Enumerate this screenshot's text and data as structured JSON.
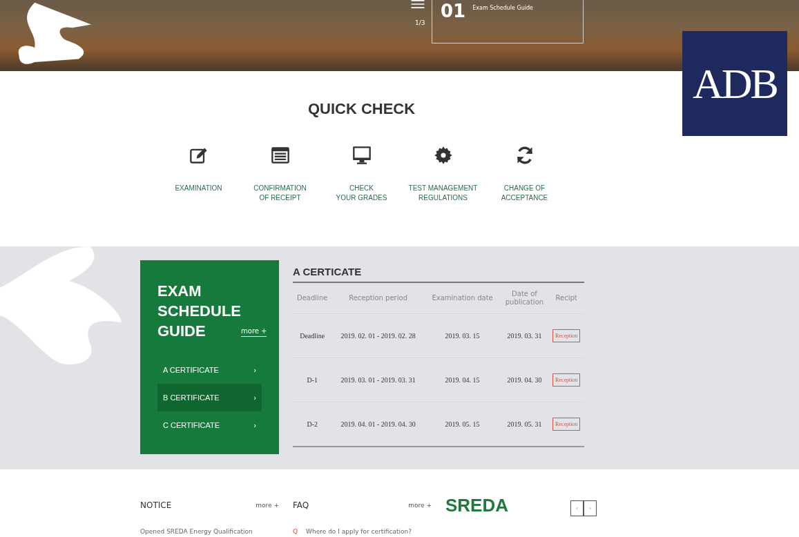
{
  "hero": {
    "number": "01",
    "caption": "Exam Schedule Guide",
    "pager": "1/3"
  },
  "logo": {
    "text": "ADB"
  },
  "quick_check": {
    "title": "QUICK CHECK",
    "items": [
      {
        "kind": "edit",
        "label": "EXAMINATION"
      },
      {
        "kind": "list",
        "label": "CONFIRMATION\nOF RECEIPT"
      },
      {
        "kind": "monitor",
        "label": "CHECK\nYOUR GRADES"
      },
      {
        "kind": "gear",
        "label": "TEST MANAGEMENT\nREGULATIONS"
      },
      {
        "kind": "refresh",
        "label": "CHANGE OF\nACCEPTANCE"
      }
    ]
  },
  "schedule": {
    "title": "EXAM\nSCHEDULE\nGUIDE",
    "more": "more +",
    "items": [
      {
        "label": "A CERTIFICATE",
        "arrow": "›",
        "selected": false
      },
      {
        "label": "B CERTIFICATE",
        "arrow": "›",
        "selected": true
      },
      {
        "label": "C CERTIFICATE",
        "arrow": "›",
        "selected": false
      }
    ],
    "table": {
      "title": "A CERTICATE",
      "columns": [
        "Deadline",
        "Reception period",
        "Examination date",
        "Date of\npublication",
        "Recipt"
      ],
      "rows": [
        {
          "cells": [
            "Deadline",
            "2019. 02. 01 - 2019. 02. 28",
            "2019. 03. 15",
            "2019. 03. 31"
          ],
          "button": "Reception"
        },
        {
          "cells": [
            "D-1",
            "2019. 03. 01 - 2019. 03. 31",
            "2019. 04. 15",
            "2019. 04. 30"
          ],
          "button": "Reception"
        },
        {
          "cells": [
            "D-2",
            "2019. 04. 01 - 2019. 04. 30",
            "2019. 05. 15",
            "2019. 05. 31"
          ],
          "button": "Reception"
        }
      ]
    }
  },
  "notice": {
    "title": "NOTICE",
    "more": "more +",
    "items": [
      "Opened SREDA Energy Qualification"
    ]
  },
  "faq": {
    "title": "FAQ",
    "more": "more +",
    "items": [
      {
        "mark": "Q",
        "text": "Where do I apply for certification?"
      }
    ]
  },
  "partner": {
    "logo": "SREDA",
    "prev": "‹",
    "next": "›"
  }
}
